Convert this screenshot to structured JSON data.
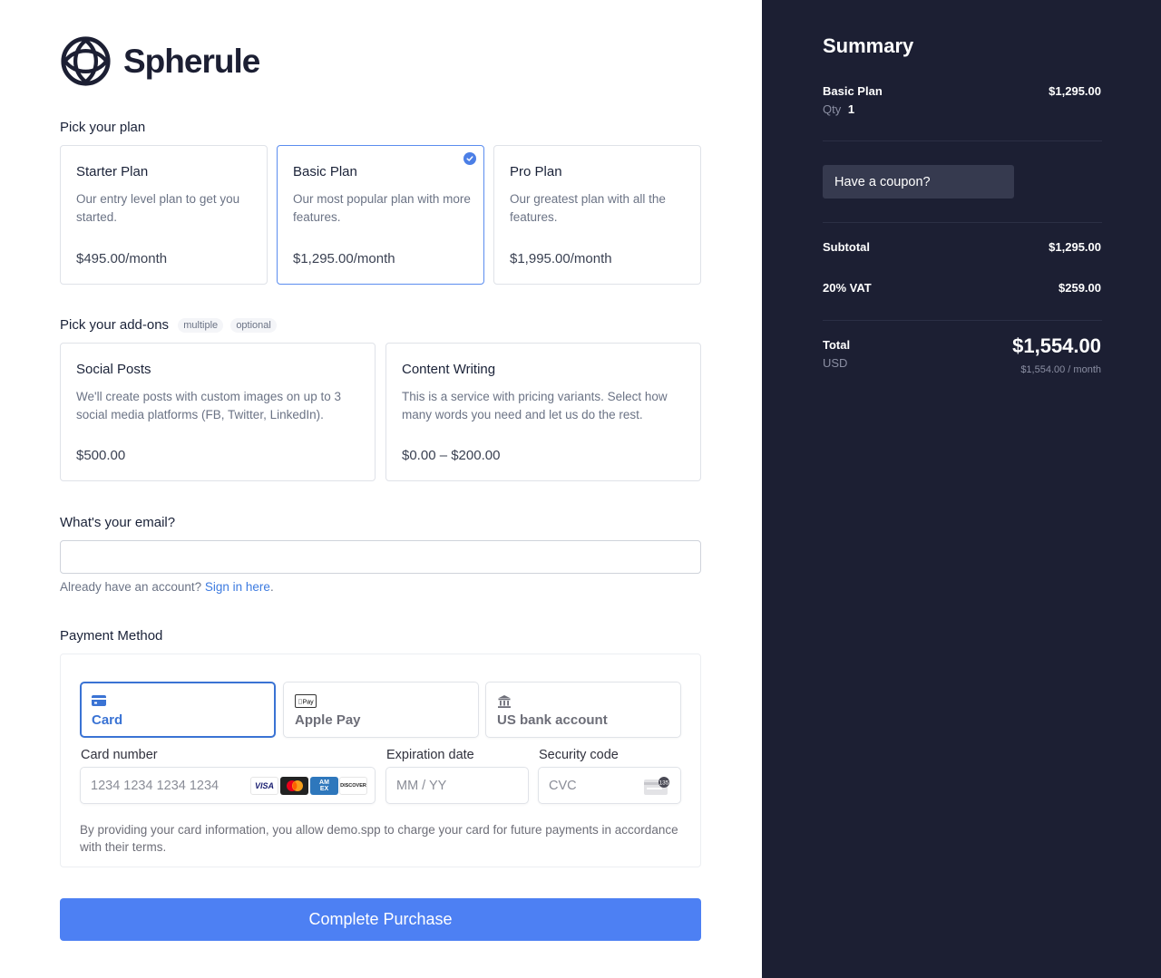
{
  "brand": {
    "name": "Spherule",
    "logo_icon": "sphere-logo-icon"
  },
  "plans": {
    "title": "Pick your plan",
    "items": [
      {
        "name": "Starter Plan",
        "description": "Our entry level plan to get you started.",
        "price": "$495.00/month",
        "selected": false
      },
      {
        "name": "Basic Plan",
        "description": "Our most popular plan with more features.",
        "price": "$1,295.00/month",
        "selected": true
      },
      {
        "name": "Pro Plan",
        "description": "Our greatest plan with all the features.",
        "price": "$1,995.00/month",
        "selected": false
      }
    ]
  },
  "addons": {
    "title": "Pick your add-ons",
    "badges": [
      "multiple",
      "optional"
    ],
    "items": [
      {
        "name": "Social Posts",
        "description": "We'll create posts with custom images on up to 3 social media platforms (FB, Twitter, LinkedIn).",
        "price": "$500.00"
      },
      {
        "name": "Content Writing",
        "description": "This is a service with pricing variants. Select how many words you need and let us do the rest.",
        "price": "$0.00 – $200.00"
      }
    ]
  },
  "email": {
    "title": "What's your email?",
    "value": "",
    "placeholder": "",
    "signin_prefix": "Already have an account?",
    "signin_link": "Sign in here",
    "signin_suffix": "."
  },
  "payment": {
    "title": "Payment Method",
    "methods": [
      {
        "label": "Card",
        "icon": "credit-card-icon",
        "active": true
      },
      {
        "label": "Apple Pay",
        "icon": "apple-pay-icon",
        "active": false
      },
      {
        "label": "US bank account",
        "icon": "bank-icon",
        "active": false
      }
    ],
    "card_number": {
      "label": "Card number",
      "placeholder": "1234 1234 1234 1234",
      "brands": [
        "VISA",
        "Mastercard",
        "AMEX",
        "DISCOVER"
      ]
    },
    "expiry": {
      "label": "Expiration date",
      "placeholder": "MM / YY"
    },
    "cvc": {
      "label": "Security code",
      "placeholder": "CVC",
      "hint_badge": "135"
    },
    "terms": "By providing your card information, you allow demo.spp to charge your card for future payments in accordance with their terms."
  },
  "submit": {
    "label": "Complete Purchase"
  },
  "summary": {
    "title": "Summary",
    "line_item": {
      "name": "Basic Plan",
      "price": "$1,295.00",
      "qty_label": "Qty",
      "qty": "1"
    },
    "coupon_label": "Have a coupon?",
    "subtotal_label": "Subtotal",
    "subtotal": "$1,295.00",
    "vat_label": "20% VAT",
    "vat": "$259.00",
    "total_label": "Total",
    "currency": "USD",
    "total": "$1,554.00",
    "total_recurring": "$1,554.00 / month"
  },
  "colors": {
    "accent": "#4d80f3",
    "selected_border": "#5b8def",
    "summary_bg": "#1c1f33",
    "card_active": "#3a73d4"
  }
}
